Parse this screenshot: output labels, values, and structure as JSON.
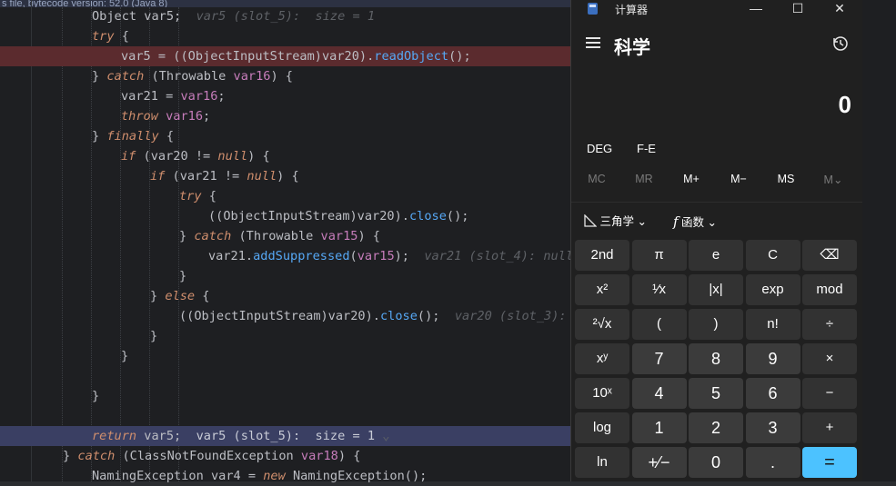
{
  "editor": {
    "banner": "s file, bytecode version: 52.0 (Java 8)",
    "lines": [
      {
        "indent": 101,
        "bg": "",
        "parts": [
          [
            "Object var5;  ",
            ""
          ],
          [
            "var5 (slot_5):  size = 1",
            "hint"
          ]
        ]
      },
      {
        "indent": 101,
        "bg": "",
        "parts": [
          [
            "try",
            "kw"
          ],
          [
            " {",
            ""
          ]
        ]
      },
      {
        "indent": 133,
        "bg": "hl-red",
        "parts": [
          [
            "var5 = ((ObjectInputStream)var20).",
            ""
          ],
          [
            "readObject",
            "fn"
          ],
          [
            "();",
            ""
          ]
        ]
      },
      {
        "indent": 101,
        "bg": "",
        "parts": [
          [
            "} ",
            ""
          ],
          [
            "catch",
            "kw"
          ],
          [
            " (Throwable ",
            ""
          ],
          [
            "var16",
            "var"
          ],
          [
            ") {",
            ""
          ]
        ]
      },
      {
        "indent": 133,
        "bg": "",
        "parts": [
          [
            "var21 = ",
            ""
          ],
          [
            "var16",
            "var"
          ],
          [
            ";",
            ""
          ]
        ]
      },
      {
        "indent": 133,
        "bg": "",
        "parts": [
          [
            "throw",
            "kw"
          ],
          [
            " ",
            ""
          ],
          [
            "var16",
            "var"
          ],
          [
            ";",
            ""
          ]
        ]
      },
      {
        "indent": 101,
        "bg": "",
        "parts": [
          [
            "} ",
            ""
          ],
          [
            "finally",
            "kw"
          ],
          [
            " {",
            ""
          ]
        ]
      },
      {
        "indent": 133,
        "bg": "",
        "parts": [
          [
            "if",
            "kw"
          ],
          [
            " (var20 != ",
            ""
          ],
          [
            "null",
            "kw"
          ],
          [
            ") {",
            ""
          ]
        ]
      },
      {
        "indent": 165,
        "bg": "",
        "parts": [
          [
            "if",
            "kw"
          ],
          [
            " (var21 != ",
            ""
          ],
          [
            "null",
            "kw"
          ],
          [
            ") {",
            ""
          ]
        ]
      },
      {
        "indent": 197,
        "bg": "",
        "parts": [
          [
            "try",
            "kw"
          ],
          [
            " {",
            ""
          ]
        ]
      },
      {
        "indent": 229,
        "bg": "",
        "parts": [
          [
            "((ObjectInputStream)var20).",
            ""
          ],
          [
            "close",
            "fn"
          ],
          [
            "();",
            ""
          ]
        ]
      },
      {
        "indent": 197,
        "bg": "",
        "parts": [
          [
            "} ",
            ""
          ],
          [
            "catch",
            "kw"
          ],
          [
            " (Throwable ",
            ""
          ],
          [
            "var15",
            "var"
          ],
          [
            ") {",
            ""
          ]
        ]
      },
      {
        "indent": 229,
        "bg": "",
        "parts": [
          [
            "var21.",
            ""
          ],
          [
            "addSuppressed",
            "fn"
          ],
          [
            "(",
            ""
          ],
          [
            "var15",
            "var"
          ],
          [
            ");  ",
            ""
          ],
          [
            "var21 (slot_4): null",
            "hint"
          ]
        ]
      },
      {
        "indent": 197,
        "bg": "",
        "parts": [
          [
            "}",
            ""
          ]
        ]
      },
      {
        "indent": 165,
        "bg": "",
        "parts": [
          [
            "} ",
            ""
          ],
          [
            "else",
            "kw"
          ],
          [
            " {",
            ""
          ]
        ]
      },
      {
        "indent": 197,
        "bg": "",
        "parts": [
          [
            "((ObjectInputStream)var20).",
            ""
          ],
          [
            "close",
            "fn"
          ],
          [
            "();  ",
            ""
          ],
          [
            "var20 (slot_3): ",
            "hint"
          ]
        ]
      },
      {
        "indent": 165,
        "bg": "",
        "parts": [
          [
            "}",
            ""
          ]
        ]
      },
      {
        "indent": 133,
        "bg": "",
        "parts": [
          [
            "}",
            ""
          ]
        ]
      },
      {
        "indent": 101,
        "bg": "",
        "parts": [
          [
            "",
            ""
          ]
        ]
      },
      {
        "indent": 101,
        "bg": "",
        "parts": [
          [
            "}",
            ""
          ]
        ]
      },
      {
        "indent": 101,
        "bg": "",
        "parts": [
          [
            "",
            ""
          ]
        ]
      },
      {
        "indent": 101,
        "bg": "hl-blue",
        "parts": [
          [
            "return",
            "kw"
          ],
          [
            " var5;  ",
            ""
          ],
          [
            "var5 (slot_5):  size = 1",
            "hint-bright"
          ],
          [
            " ⌄",
            "hint"
          ]
        ]
      },
      {
        "indent": 69,
        "bg": "",
        "parts": [
          [
            "} ",
            ""
          ],
          [
            "catch",
            "kw"
          ],
          [
            " (ClassNotFoundException ",
            ""
          ],
          [
            "var18",
            "var"
          ],
          [
            ") {",
            ""
          ]
        ]
      },
      {
        "indent": 101,
        "bg": "",
        "parts": [
          [
            "NamingException var4 = ",
            ""
          ],
          [
            "new",
            "kw"
          ],
          [
            " NamingException();",
            ""
          ]
        ]
      }
    ]
  },
  "calculator": {
    "app_title": "计算器",
    "mode_title": "科学",
    "display_value": "0",
    "angle_mode": "DEG",
    "fe_mode": "F-E",
    "memory": [
      "MC",
      "MR",
      "M+",
      "M−",
      "MS",
      "M⌄"
    ],
    "memory_dim": [
      true,
      true,
      false,
      false,
      false,
      true
    ],
    "trig_label": "三角学",
    "func_label": "函数",
    "keys": [
      [
        "2nd",
        "π",
        "e",
        "C",
        "⌫"
      ],
      [
        "x²",
        "¹⁄x",
        "|x|",
        "exp",
        "mod"
      ],
      [
        "²√x",
        "(",
        ")",
        "n!",
        "÷"
      ],
      [
        "xʸ",
        "7",
        "8",
        "9",
        "×"
      ],
      [
        "10ˣ",
        "4",
        "5",
        "6",
        "−"
      ],
      [
        "log",
        "1",
        "2",
        "3",
        "+"
      ],
      [
        "ln",
        "+⁄−",
        "0",
        ".",
        "="
      ]
    ]
  }
}
